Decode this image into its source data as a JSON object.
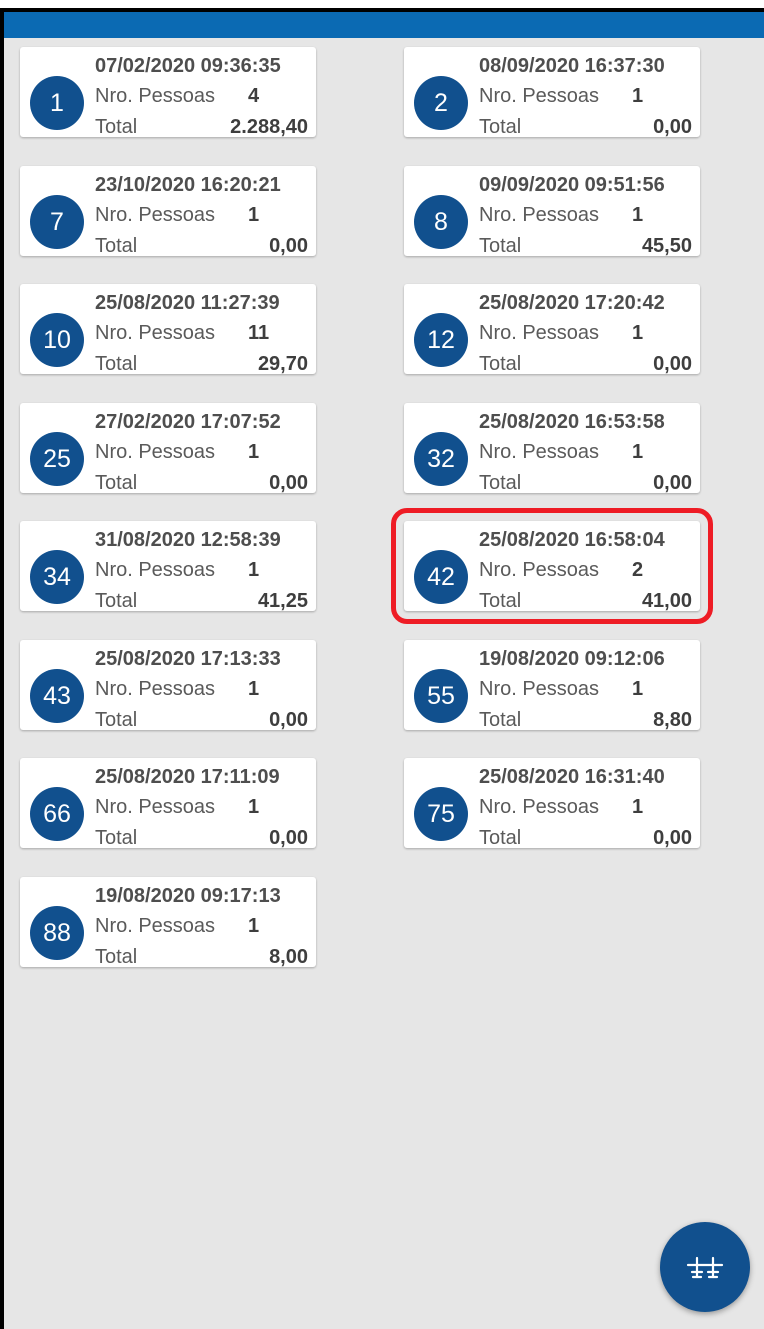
{
  "app": {
    "accent": "#0b6ab3",
    "badge_color": "#11508e",
    "highlight_color": "#ee1c25"
  },
  "labels": {
    "people": "Nro. Pessoas",
    "total": "Total"
  },
  "tables": [
    {
      "number": "1",
      "datetime": "07/02/2020 09:36:35",
      "people": "4",
      "total": "2.288,40",
      "selected": false
    },
    {
      "number": "2",
      "datetime": "08/09/2020 16:37:30",
      "people": "1",
      "total": "0,00",
      "selected": false
    },
    {
      "number": "7",
      "datetime": "23/10/2020 16:20:21",
      "people": "1",
      "total": "0,00",
      "selected": false
    },
    {
      "number": "8",
      "datetime": "09/09/2020 09:51:56",
      "people": "1",
      "total": "45,50",
      "selected": false
    },
    {
      "number": "10",
      "datetime": "25/08/2020 11:27:39",
      "people": "11",
      "total": "29,70",
      "selected": false
    },
    {
      "number": "12",
      "datetime": "25/08/2020 17:20:42",
      "people": "1",
      "total": "0,00",
      "selected": false
    },
    {
      "number": "25",
      "datetime": "27/02/2020 17:07:52",
      "people": "1",
      "total": "0,00",
      "selected": false
    },
    {
      "number": "32",
      "datetime": "25/08/2020 16:53:58",
      "people": "1",
      "total": "0,00",
      "selected": false
    },
    {
      "number": "34",
      "datetime": "31/08/2020 12:58:39",
      "people": "1",
      "total": "41,25",
      "selected": false
    },
    {
      "number": "42",
      "datetime": "25/08/2020 16:58:04",
      "people": "2",
      "total": "41,00",
      "selected": true
    },
    {
      "number": "43",
      "datetime": "25/08/2020 17:13:33",
      "people": "1",
      "total": "0,00",
      "selected": false
    },
    {
      "number": "55",
      "datetime": "19/08/2020 09:12:06",
      "people": "1",
      "total": "8,80",
      "selected": false
    },
    {
      "number": "66",
      "datetime": "25/08/2020 17:11:09",
      "people": "1",
      "total": "0,00",
      "selected": false
    },
    {
      "number": "75",
      "datetime": "25/08/2020 16:31:40",
      "people": "1",
      "total": "0,00",
      "selected": false
    },
    {
      "number": "88",
      "datetime": "19/08/2020 09:17:13",
      "people": "1",
      "total": "8,00",
      "selected": false
    }
  ],
  "fab": {
    "icon": "tables-icon"
  }
}
